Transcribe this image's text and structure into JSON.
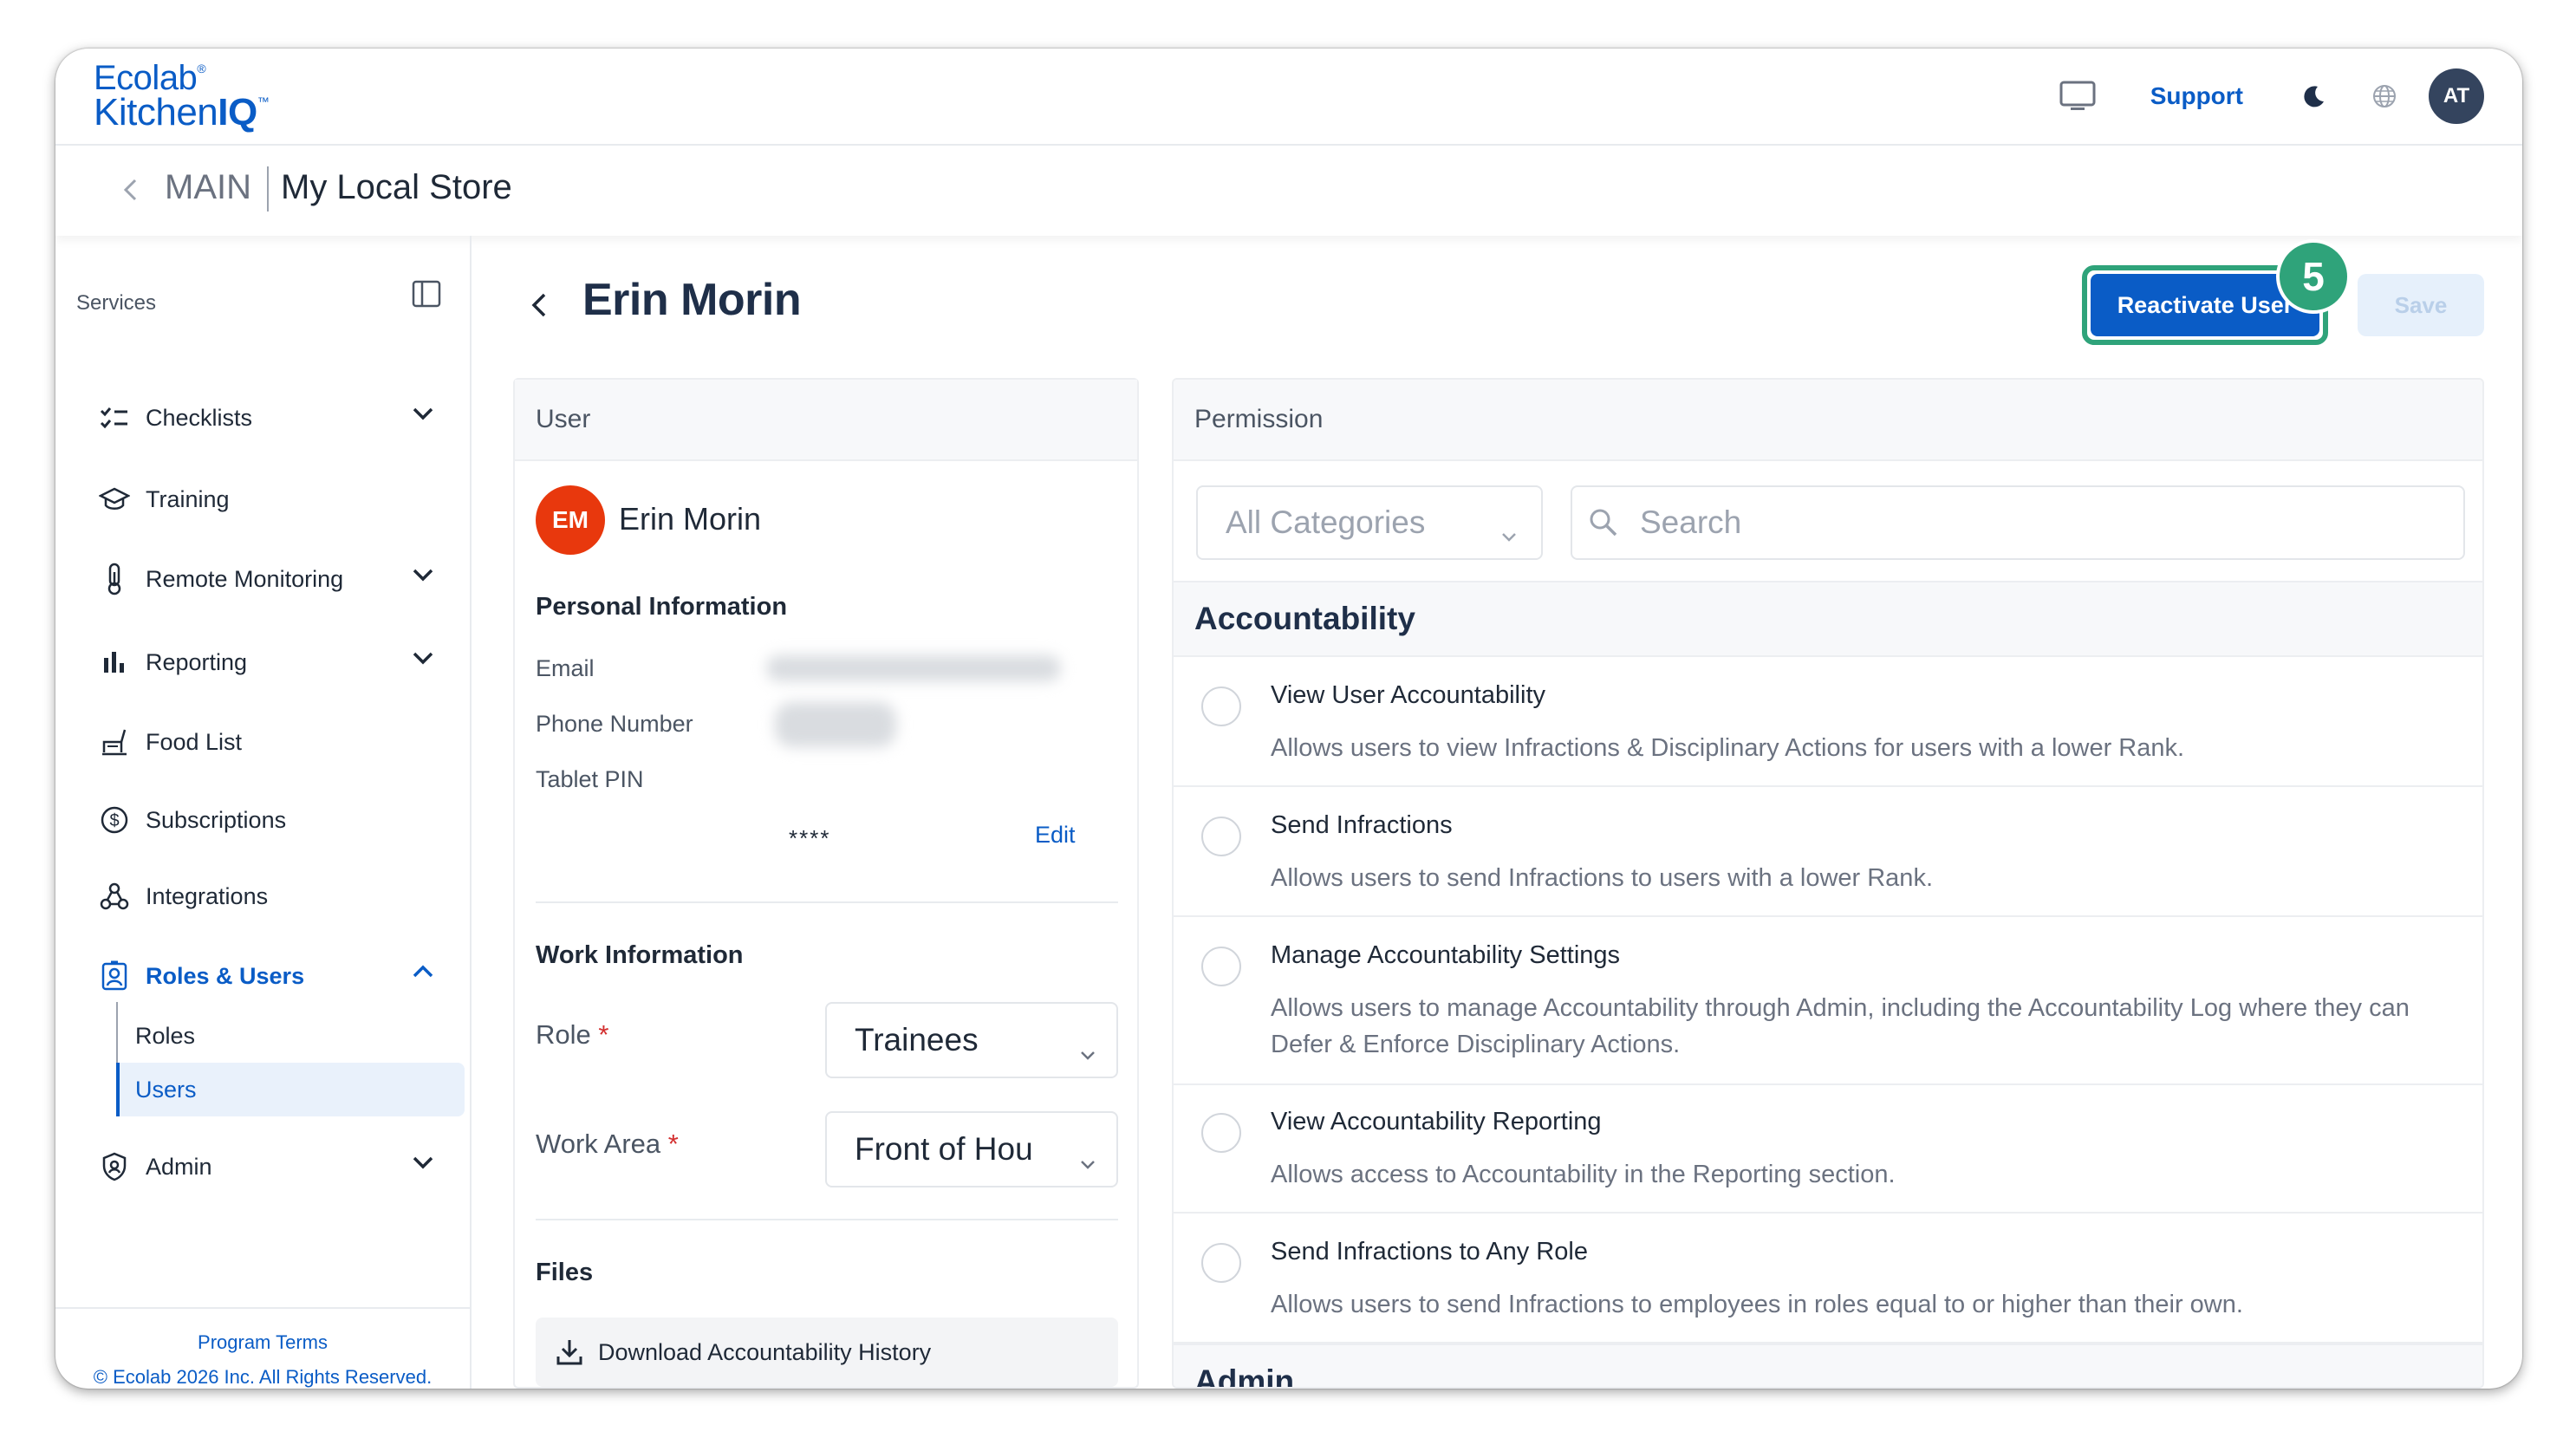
{
  "header": {
    "logo_line1": "Ecolab",
    "logo_reg": "®",
    "logo_line2_a": "Kitchen",
    "logo_line2_b": "IQ",
    "logo_tm": "™",
    "support_label": "Support",
    "avatar_initials": "AT"
  },
  "breadcrumb": {
    "main": "MAIN",
    "store": "My Local Store"
  },
  "sidebar": {
    "section_label": "Services",
    "items": [
      {
        "label": "Checklists",
        "icon": "checklist-icon"
      },
      {
        "label": "Training",
        "icon": "graduation-cap-icon"
      },
      {
        "label": "Remote Monitoring",
        "icon": "thermometer-icon"
      },
      {
        "label": "Reporting",
        "icon": "bar-chart-icon"
      },
      {
        "label": "Food List",
        "icon": "food-list-icon"
      },
      {
        "label": "Subscriptions",
        "icon": "dollar-circle-icon"
      },
      {
        "label": "Integrations",
        "icon": "integrations-icon"
      },
      {
        "label": "Roles & Users",
        "icon": "id-badge-icon"
      },
      {
        "label": "Admin",
        "icon": "shield-icon"
      }
    ],
    "sub_items": [
      {
        "label": "Roles"
      },
      {
        "label": "Users"
      }
    ],
    "footer": {
      "terms": "Program Terms",
      "copyright": "© Ecolab 2026 Inc. All Rights Reserved."
    }
  },
  "page": {
    "title": "Erin Morin",
    "reactivate_label": "Reactivate User",
    "step_number": "5",
    "save_label": "Save"
  },
  "user_card": {
    "header": "User",
    "avatar_initials": "EM",
    "name": "Erin Morin",
    "personal_info_title": "Personal Information",
    "email_label": "Email",
    "phone_label": "Phone Number",
    "pin_label": "Tablet PIN",
    "pin_value": "****",
    "edit_label": "Edit",
    "work_info_title": "Work Information",
    "role_label": "Role",
    "role_value": "Trainees",
    "work_area_label": "Work Area",
    "work_area_value": "Front of Hou",
    "required_mark": "*",
    "files_title": "Files",
    "download_label": "Download Accountability History"
  },
  "permission_card": {
    "header": "Permission",
    "category_placeholder": "All Categories",
    "search_placeholder": "Search",
    "groups": [
      {
        "title": "Accountability"
      },
      {
        "title": "Admin"
      }
    ],
    "permissions": [
      {
        "title": "View User Accountability",
        "desc": "Allows users to view Infractions & Disciplinary Actions for users with a lower Rank."
      },
      {
        "title": "Send Infractions",
        "desc": "Allows users to send Infractions to users with a lower Rank."
      },
      {
        "title": "Manage Accountability Settings",
        "desc": "Allows users to manage Accountability through Admin, including the Accountability Log where they can Defer & Enforce Disciplinary Actions."
      },
      {
        "title": "View Accountability Reporting",
        "desc": "Allows access to Accountability in the Reporting section."
      },
      {
        "title": "Send Infractions to Any Role",
        "desc": "Allows users to send Infractions to employees in roles equal to or higher than their own."
      }
    ]
  },
  "colors": {
    "brand_blue": "#0a5cc6",
    "highlight_green": "#2fa37a",
    "avatar_orange": "#e8380d",
    "avatar_navy": "#34445e"
  }
}
